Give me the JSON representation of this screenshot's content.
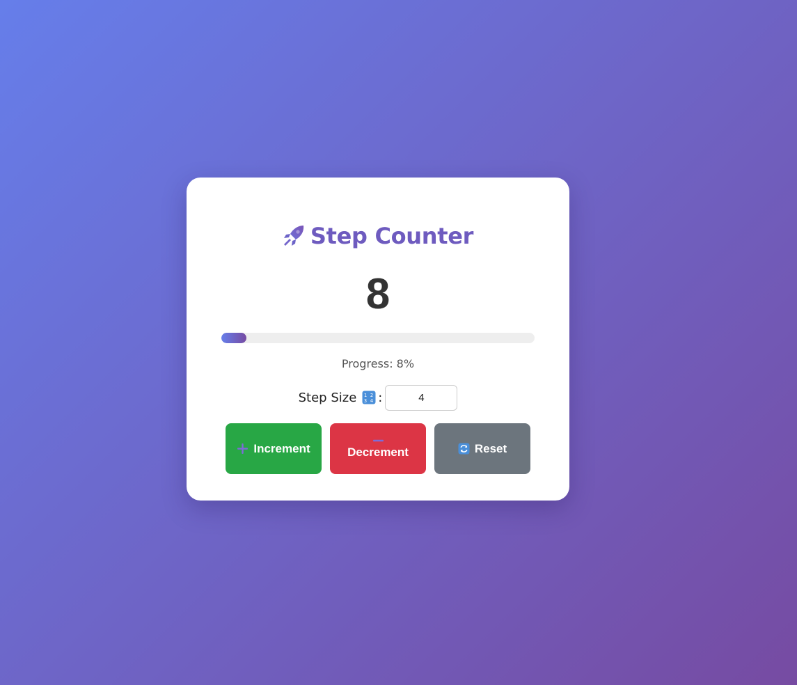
{
  "header": {
    "title": "Step Counter",
    "title_icon": "rocket-icon"
  },
  "counter": {
    "value": "8"
  },
  "progress": {
    "percent": 8,
    "label": "Progress: 8%"
  },
  "step": {
    "label": "Step Size",
    "icon": "input-numbers-icon",
    "colon": ":",
    "value": "4"
  },
  "buttons": {
    "increment": "Increment",
    "decrement": "Decrement",
    "reset": "Reset"
  },
  "colors": {
    "gradient_start": "#667eea",
    "gradient_end": "#764ba2",
    "increment": "#28a745",
    "decrement": "#dc3545",
    "reset": "#6c757d"
  }
}
